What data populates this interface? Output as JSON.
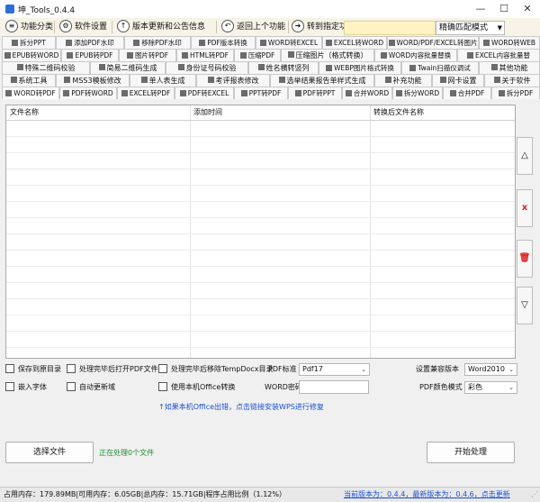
{
  "window": {
    "title": "坤_Tools_0.4.4",
    "minimize": "—",
    "maximize": "☐",
    "close": "✕"
  },
  "toolbar": {
    "items": [
      {
        "label": "功能分类",
        "icon": "≡"
      },
      {
        "label": "软件设置",
        "icon": "⚙"
      },
      {
        "label": "版本更新和公告信息",
        "icon": "↑"
      },
      {
        "label": "返回上个功能",
        "icon": "↶"
      },
      {
        "label": "转到指定功能",
        "icon": "➜"
      }
    ],
    "mode_select": "精确匹配模式"
  },
  "tab_rows": [
    [
      "拆分PPT",
      "添加PDF水印",
      "移除PDF水印",
      "PDF版本转换",
      "WORD转EXCEL",
      "EXCEL转WORD",
      "WORD/PDF/EXCEL转图片",
      "WORD转WEB"
    ],
    [
      "EPUB转WORD",
      "EPUB转PDF",
      "图片转PDF",
      "HTML转PDF",
      "压缩PDF",
      "压缩图片（格式转换）",
      "WORD内容批量替换",
      "EXCEL内容批量替"
    ],
    [
      "特殊二维码校验",
      "简易二维码生成",
      "身份证号码校验",
      "姓名横转竖列",
      "WEBP图片格式转换",
      "Twain扫描仪调试",
      "其他功能"
    ],
    [
      "系统工具",
      "MSS3模板修改",
      "单人表生成",
      "考评报表修改",
      "选举结果报告单样式生成",
      "补充功能",
      "网卡设置",
      "关于软件"
    ],
    [
      "WORD转PDF",
      "PDF转WORD",
      "EXCEL转PDF",
      "PDF转EXCEL",
      "PPT转PDF",
      "PDF转PPT",
      "合并WORD",
      "拆分WORD",
      "合并PDF",
      "拆分PDF"
    ]
  ],
  "grid": {
    "columns": [
      "文件名称",
      "添加时间",
      "转换后文件名称"
    ]
  },
  "side_buttons": [
    "△",
    "x",
    "🗑",
    "▽"
  ],
  "options": {
    "save_to_original": "保存到原目录",
    "open_pdf_after": "处理完毕后打开PDF文件",
    "remove_tempdocx": "处理完毕后移除TempDocx目录",
    "pdf_standard_label": "PDF标准",
    "pdf_standard_value": "Pdf17",
    "compat_label": "设置兼容版本",
    "compat_value": "Word2010",
    "embed_fonts": "嵌入字体",
    "auto_update_fields": "自动更新域",
    "use_office": "使用本机Office转换",
    "word_password_label": "WORD密码",
    "pdf_color_label": "PDF颜色模式",
    "pdf_color_value": "彩色"
  },
  "office_link": "↑如果本机Office出错，点击链接安装WPS进行修复",
  "actions": {
    "select_files": "选择文件",
    "processing_status": "正在处理0个文件",
    "start": "开始处理"
  },
  "status": {
    "memory": "占用内存：179.89MB|可用内存：6.05GB|总内存：15.71GB|程序占用比例（1.12%）",
    "version": "当前版本为：0.4.4，最新版本为：0.4.6，点击更新"
  }
}
